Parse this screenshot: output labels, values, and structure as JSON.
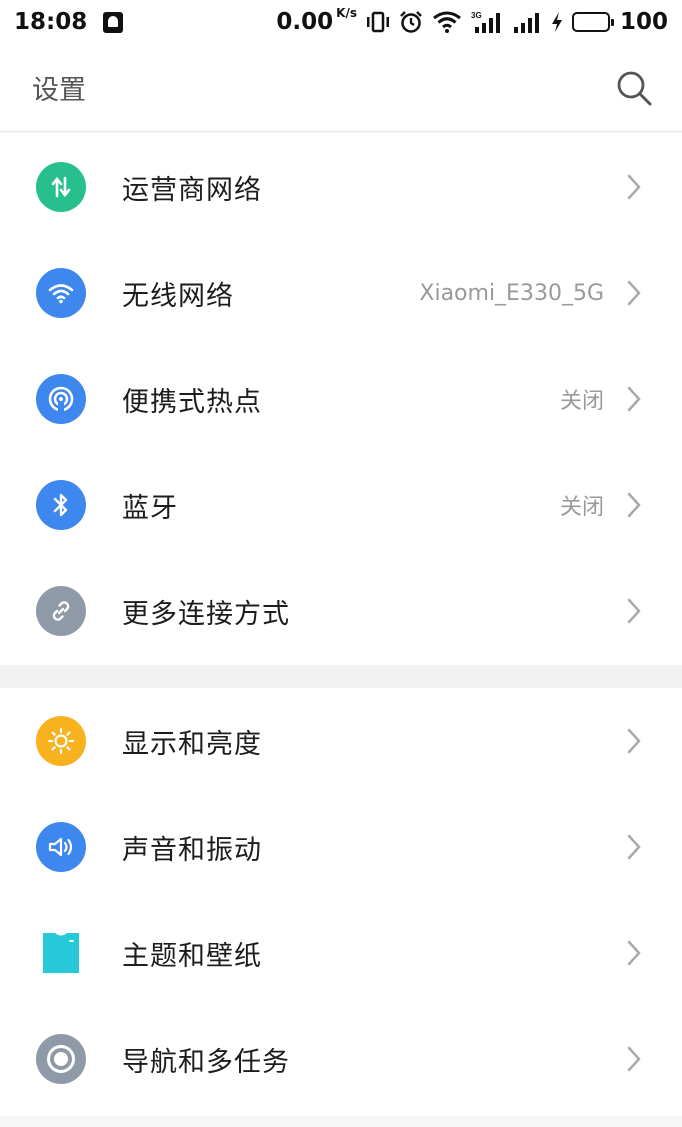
{
  "status_bar": {
    "time": "18:08",
    "net_speed": "0.00",
    "net_speed_unit": "K/s",
    "network_type": "3G",
    "battery_level": "100",
    "icons": [
      "notification-icon",
      "vibrate-icon",
      "alarm-icon",
      "wifi-icon",
      "signal-3g-icon",
      "signal-icon",
      "charging-icon",
      "battery-icon"
    ]
  },
  "header": {
    "title": "设置",
    "search_icon": "search-icon"
  },
  "sections": [
    {
      "items": [
        {
          "label": "运营商网络",
          "value": "",
          "icon": "mobile-data-icon",
          "color": "#27bf8e"
        },
        {
          "label": "无线网络",
          "value": "Xiaomi_E330_5G",
          "icon": "wifi-icon",
          "color": "#3d87ee"
        },
        {
          "label": "便携式热点",
          "value": "关闭",
          "icon": "hotspot-icon",
          "color": "#3d87ee"
        },
        {
          "label": "蓝牙",
          "value": "关闭",
          "icon": "bluetooth-icon",
          "color": "#3d87ee"
        },
        {
          "label": "更多连接方式",
          "value": "",
          "icon": "link-icon",
          "color": "#8f9aa8"
        }
      ]
    },
    {
      "items": [
        {
          "label": "显示和亮度",
          "value": "",
          "icon": "brightness-icon",
          "color": "#f7b21e"
        },
        {
          "label": "声音和振动",
          "value": "",
          "icon": "sound-icon",
          "color": "#3d87ee"
        },
        {
          "label": "主题和壁纸",
          "value": "",
          "icon": "theme-shirt-icon",
          "color": "#26c9d8"
        },
        {
          "label": "导航和多任务",
          "value": "",
          "icon": "navigation-icon",
          "color": "#8f9aa8"
        }
      ]
    }
  ],
  "colors": {
    "chevron": "#a8a8a8",
    "secondary_text": "#9a9a9a",
    "section_divider": "#f2f2f2"
  }
}
